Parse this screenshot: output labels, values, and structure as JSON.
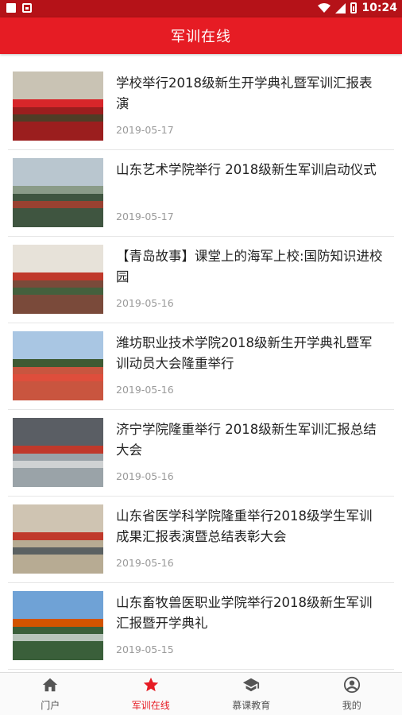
{
  "statusbar": {
    "time": "10:24"
  },
  "appbar": {
    "title": "军训在线"
  },
  "articles": [
    {
      "title": "学校举行2018级新生开学典礼暨军训汇报表演",
      "date": "2019-05-17",
      "thumb": {
        "sky": "#c9c3b4",
        "ground": "#9b1e1e",
        "band": "#d8262a",
        "accent": "#2f4a2a"
      }
    },
    {
      "title": "山东艺术学院举行 2018级新生军训启动仪式",
      "date": "2019-05-17",
      "thumb": {
        "sky": "#b9c6cf",
        "ground": "#3f5540",
        "band": "#8a9b88",
        "accent": "#c0392b"
      }
    },
    {
      "title": "【青岛故事】课堂上的海军上校:国防知识进校园",
      "date": "2019-05-16",
      "thumb": {
        "sky": "#e7e2d9",
        "ground": "#7a4a3a",
        "band": "#c0392b",
        "accent": "#2d6a3f"
      }
    },
    {
      "title": "潍坊职业技术学院2018级新生开学典礼暨军训动员大会隆重举行",
      "date": "2019-05-16",
      "thumb": {
        "sky": "#a9c6e3",
        "ground": "#c9553f",
        "band": "#3e5a33",
        "accent": "#e74c3c"
      }
    },
    {
      "title": "济宁学院隆重举行 2018级新生军训汇报总结大会",
      "date": "2019-05-16",
      "thumb": {
        "sky": "#5a5e64",
        "ground": "#9aa3a8",
        "band": "#c0392b",
        "accent": "#e6e6e6"
      }
    },
    {
      "title": "山东省医学科学院隆重举行2018级学生军训成果汇报表演暨总结表彰大会",
      "date": "2019-05-16",
      "thumb": {
        "sky": "#cfc4b2",
        "ground": "#b7ab93",
        "band": "#c0392b",
        "accent": "#33414d"
      }
    },
    {
      "title": "山东畜牧兽医职业学院举行2018级新生军训汇报暨开学典礼",
      "date": "2019-05-15",
      "thumb": {
        "sky": "#6fa2d6",
        "ground": "#3a5f3a",
        "band": "#d35400",
        "accent": "#ecf0f1"
      }
    }
  ],
  "nav": [
    {
      "label": "门户",
      "icon": "home-icon",
      "active": false
    },
    {
      "label": "军训在线",
      "icon": "star-icon",
      "active": true
    },
    {
      "label": "慕课教育",
      "icon": "graduation-cap-icon",
      "active": false
    },
    {
      "label": "我的",
      "icon": "user-icon",
      "active": false
    }
  ],
  "colors": {
    "primary": "#e61c24",
    "statusbar": "#b51218",
    "inactive": "#555555"
  }
}
